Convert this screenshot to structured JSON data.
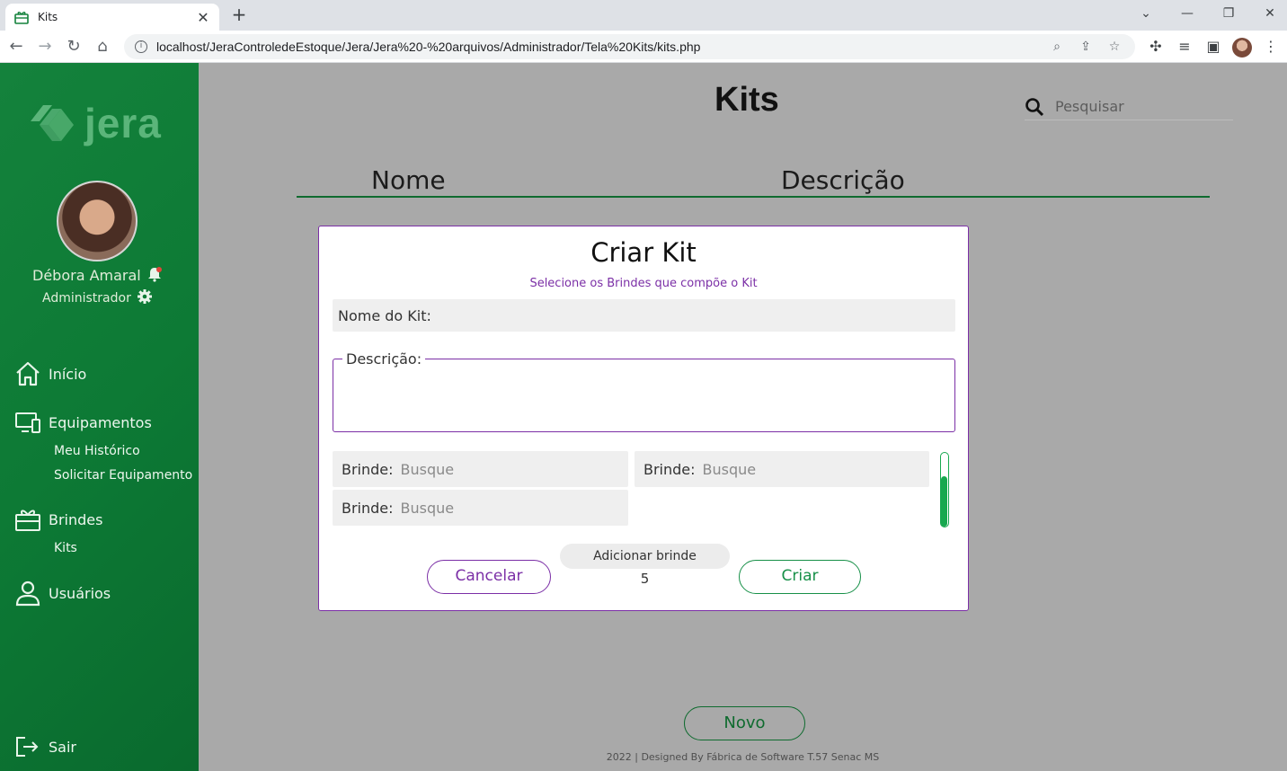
{
  "browser": {
    "tab_title": "Kits",
    "url": "localhost/JeraControledeEstoque/Jera/Jera%20-%20arquivos/Administrador/Tela%20Kits/kits.php"
  },
  "sidebar": {
    "logo_text": "jera",
    "user_name": "Débora Amaral",
    "user_role": "Administrador",
    "nav": {
      "inicio": "Início",
      "equipamentos": "Equipamentos",
      "meu_historico": "Meu Histórico",
      "solicitar_equipamento": "Solicitar Equipamento",
      "brindes": "Brindes",
      "kits": "Kits",
      "usuarios": "Usuários",
      "sair": "Sair"
    }
  },
  "main": {
    "title": "Kits",
    "search_placeholder": "Pesquisar",
    "columns": [
      "Nome",
      "Descrição"
    ],
    "new_button": "Novo",
    "footer": "2022 | Designed By Fábrica de Software T.57 Senac MS"
  },
  "modal": {
    "title": "Criar Kit",
    "subtitle": "Selecione os Brindes que compõe o Kit",
    "kit_name_placeholder": "Nome do Kit:",
    "description_legend": "Descrição:",
    "brinde_label": "Brinde:",
    "brinde_placeholder": "Busque",
    "add_button": "Adicionar brinde",
    "count": "5",
    "cancel_button": "Cancelar",
    "create_button": "Criar"
  },
  "colors": {
    "sidebar_green": "#0d7a35",
    "accent_purple": "#7b2fa6",
    "accent_green": "#179048",
    "overlay_gray": "#a9a9a9"
  }
}
